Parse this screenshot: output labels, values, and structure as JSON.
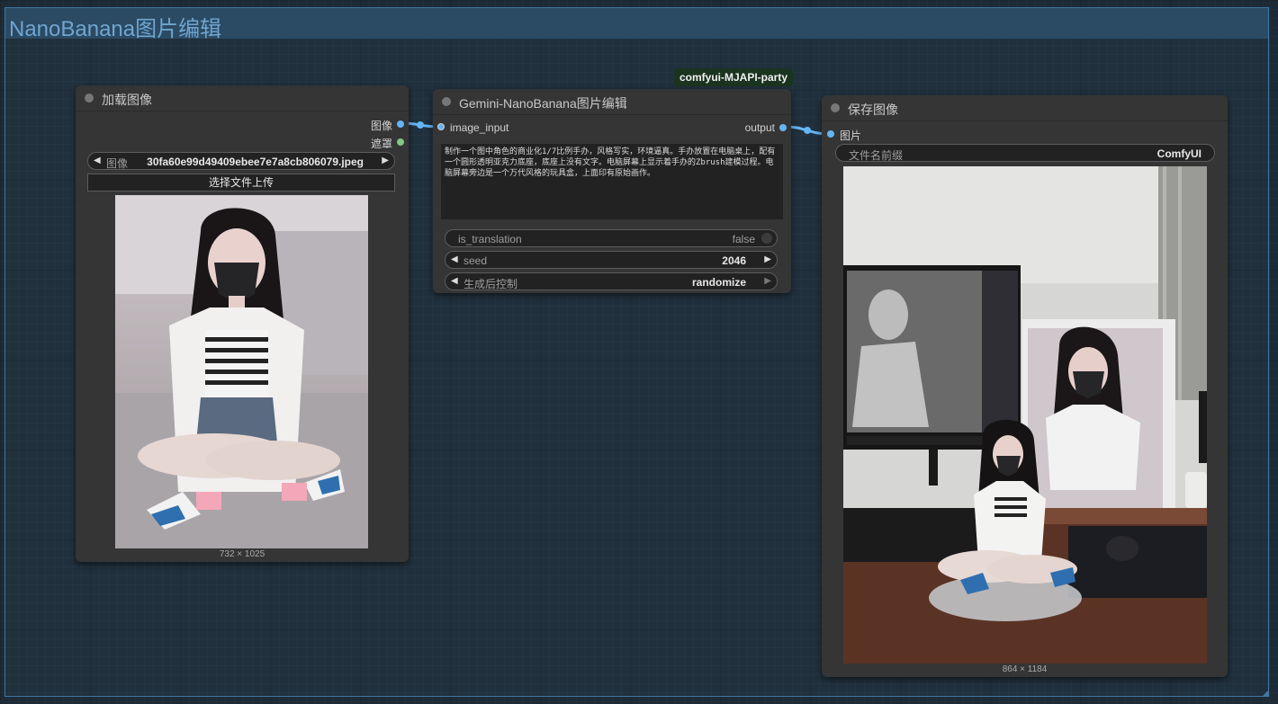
{
  "group": {
    "title": "NanoBanana图片编辑"
  },
  "badge": "comfyui-MJAPI-party",
  "colors": {
    "canvas": "#1e2b36",
    "group_border": "#3f78a3",
    "group_title": "#6fa5d0",
    "node_body": "#353535",
    "slot_image": "#64b5f6",
    "slot_mask": "#81c784",
    "link": "#64b5f6"
  },
  "load_image_node": {
    "title": "加载图像",
    "outputs": [
      "图像",
      "遮罩"
    ],
    "image_widget": {
      "label": "图像",
      "value": "30fa60e99d49409ebee7e7a8cb806079.jpeg"
    },
    "upload_button": "选择文件上传",
    "preview_caption": "732 × 1025"
  },
  "gemini_node": {
    "title": "Gemini-NanoBanana图片编辑",
    "input": "image_input",
    "output": "output",
    "prompt": "制作一个图中角色的商业化1/7比例手办，风格写实，环境逼真。手办放置在电脑桌上，配有一个圆形透明亚克力底座，底座上没有文字。电脑屏幕上显示着手办的Zbrush建模过程。电脑屏幕旁边是一个万代风格的玩具盒，上面印有原始画作。",
    "is_translation": {
      "label": "is_translation",
      "value": "false"
    },
    "seed": {
      "label": "seed",
      "value": "2046"
    },
    "control": {
      "label": "生成后控制",
      "value": "randomize"
    }
  },
  "save_image_node": {
    "title": "保存图像",
    "input": "图片",
    "prefix": {
      "label": "文件名前缀",
      "value": "ComfyUI"
    },
    "preview_caption": "864 × 1184"
  },
  "icons": [
    "arrow-left-icon",
    "arrow-right-icon",
    "toggle-icon",
    "photo-thumbnail-icon"
  ]
}
